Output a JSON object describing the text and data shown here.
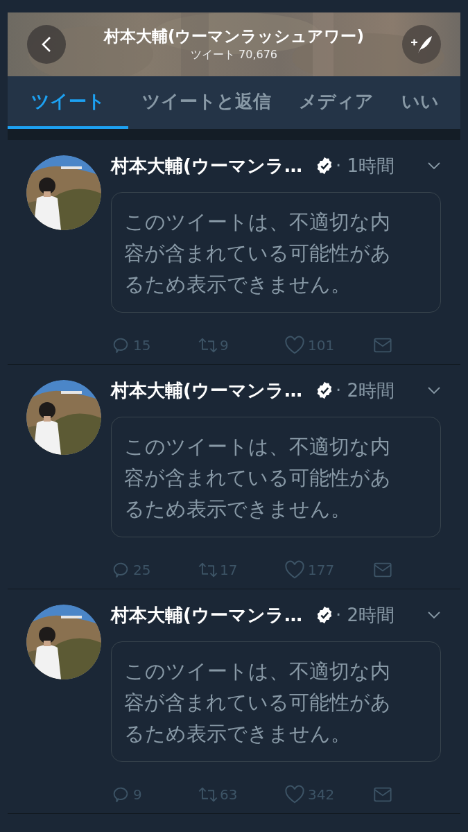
{
  "header": {
    "title": "村本大輔(ウーマンラッシュアワー)",
    "subtitle": "ツイート 70,676"
  },
  "tabs": [
    {
      "label": "ツイート",
      "selected": true
    },
    {
      "label": "ツイートと返信",
      "selected": false
    },
    {
      "label": "メディア",
      "selected": false
    },
    {
      "label": "いい",
      "selected": false
    }
  ],
  "tweets": [
    {
      "name": "村本大輔(ウーマンラ…",
      "verified": true,
      "time": "· 1時間",
      "notice": "このツイートは、不適切な内容が含まれている可能性があるため表示できません。",
      "replies": "15",
      "retweets": "9",
      "likes": "101"
    },
    {
      "name": "村本大輔(ウーマンラ…",
      "verified": true,
      "time": "· 2時間",
      "notice": "このツイートは、不適切な内容が含まれている可能性があるため表示できません。",
      "replies": "25",
      "retweets": "17",
      "likes": "177"
    },
    {
      "name": "村本大輔(ウーマンラ…",
      "verified": true,
      "time": "· 2時間",
      "notice": "このツイートは、不適切な内容が含まれている可能性があるため表示できません。",
      "replies": "9",
      "retweets": "63",
      "likes": "342"
    }
  ]
}
